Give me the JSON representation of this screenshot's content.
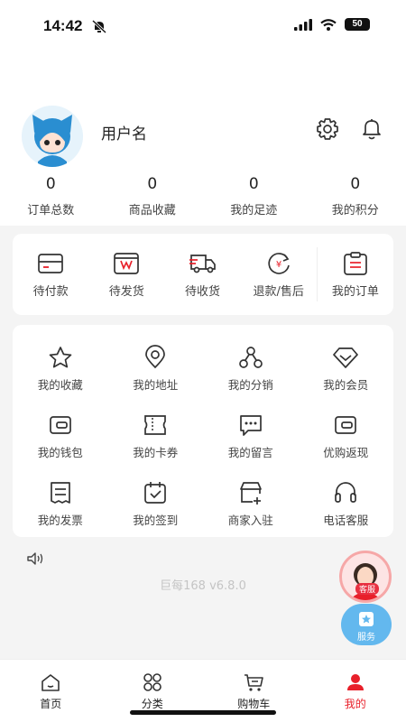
{
  "status_bar": {
    "time": "14:42",
    "battery": "50"
  },
  "profile": {
    "username": "用户名"
  },
  "stats": [
    {
      "value": "0",
      "label": "订单总数"
    },
    {
      "value": "0",
      "label": "商品收藏"
    },
    {
      "value": "0",
      "label": "我的足迹"
    },
    {
      "value": "0",
      "label": "我的积分"
    }
  ],
  "orders": {
    "items": [
      {
        "label": "待付款",
        "icon": "wallet-icon"
      },
      {
        "label": "待发货",
        "icon": "package-icon"
      },
      {
        "label": "待收货",
        "icon": "truck-icon"
      },
      {
        "label": "退款/售后",
        "icon": "refund-icon"
      }
    ],
    "all": {
      "label": "我的订单",
      "icon": "clipboard-icon"
    }
  },
  "services": [
    {
      "label": "我的收藏",
      "icon": "star-icon"
    },
    {
      "label": "我的地址",
      "icon": "location-icon"
    },
    {
      "label": "我的分销",
      "icon": "share-network-icon"
    },
    {
      "label": "我的会员",
      "icon": "diamond-icon"
    },
    {
      "label": "我的钱包",
      "icon": "wallet-icon"
    },
    {
      "label": "我的卡券",
      "icon": "ticket-icon"
    },
    {
      "label": "我的留言",
      "icon": "message-icon"
    },
    {
      "label": "优购返现",
      "icon": "cashback-icon"
    },
    {
      "label": "我的发票",
      "icon": "invoice-icon"
    },
    {
      "label": "我的签到",
      "icon": "checkin-icon"
    },
    {
      "label": "商家入驻",
      "icon": "store-icon"
    },
    {
      "label": "电话客服",
      "icon": "headset-icon"
    }
  ],
  "version": "巨每168 v6.8.0",
  "floating": {
    "kefu_label": "客服",
    "fuwu_label": "服务"
  },
  "tabs": [
    {
      "label": "首页",
      "icon": "home-icon"
    },
    {
      "label": "分类",
      "icon": "grid-icon"
    },
    {
      "label": "购物车",
      "icon": "cart-icon"
    },
    {
      "label": "我的",
      "icon": "user-icon"
    }
  ],
  "colors": {
    "accent": "#e8202a",
    "icon_stroke": "#333333",
    "floating_blue": "#63b8ee"
  }
}
